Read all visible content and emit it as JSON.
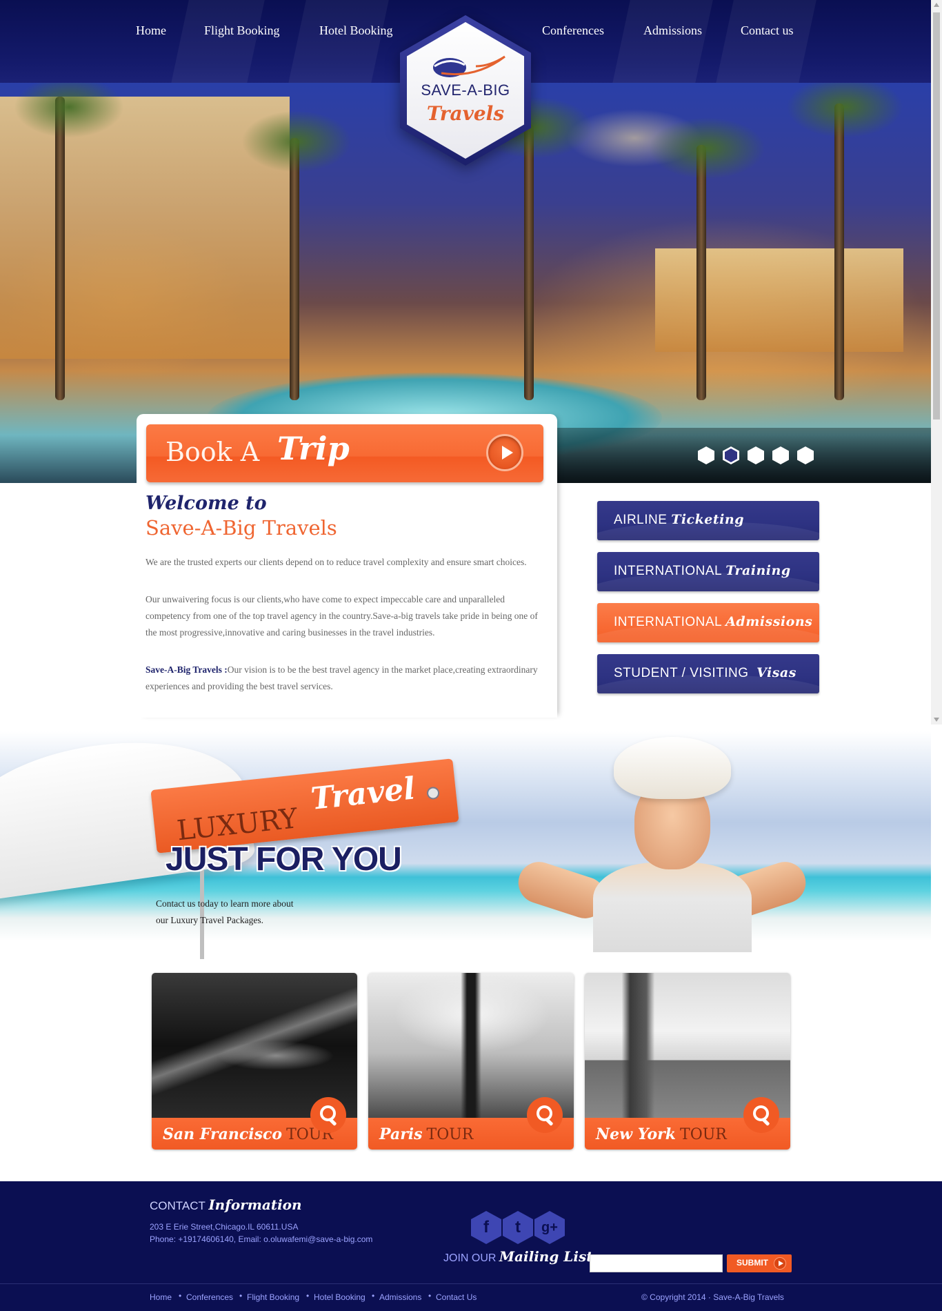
{
  "nav": {
    "items": [
      {
        "label": "Home"
      },
      {
        "label": "Flight Booking"
      },
      {
        "label": "Hotel Booking"
      },
      {
        "label": "Conferences"
      },
      {
        "label": "Admissions"
      },
      {
        "label": "Contact us"
      }
    ]
  },
  "logo": {
    "line1": "SAVE-A-BIG",
    "line2": "Travels"
  },
  "slider": {
    "dots": 5,
    "active_index": 1
  },
  "book": {
    "label_plain": "Book A",
    "label_script": "Trip",
    "icon": "play-icon"
  },
  "welcome": {
    "script": "Welcome to",
    "title": "Save-A-Big Travels",
    "p1": "We are the trusted experts our clients depend on to reduce travel complexity and ensure smart choices.",
    "p2": "Our unwaivering focus is our clients,who have come to expect impeccable care and unparalleled competency from one of the top travel agency in the country.Save-a-big travels take pride in being one of the most progressive,innovative and caring businesses in the travel industries.",
    "p3_bold": "Save-A-Big Travels :",
    "p3": "Our vision is to be the best travel agency in the market place,creating extraordinary experiences and providing the best travel services."
  },
  "services": [
    {
      "plain": "AIRLINE",
      "script": "Ticketing",
      "color": "#2d3282"
    },
    {
      "plain": "INTERNATIONAL",
      "script": "Training",
      "color": "#2d3282"
    },
    {
      "plain": "INTERNATIONAL",
      "script": "Admissions",
      "color": "#f86a34"
    },
    {
      "plain": "STUDENT / VISITING",
      "script": "Visas",
      "color": "#2d3282"
    }
  ],
  "luxury": {
    "tag_plain": "LUXURY",
    "tag_script": "Travel",
    "headline": "JUST FOR YOU",
    "text_line1": "Contact us today to learn more about",
    "text_line2": "our Luxury Travel Packages."
  },
  "tours": [
    {
      "script": "San Francisco",
      "plain": "TOUR"
    },
    {
      "script": "Paris",
      "plain": "TOUR"
    },
    {
      "script": "New York",
      "plain": "TOUR"
    }
  ],
  "footer": {
    "contact_plain": "CONTACT",
    "contact_script": "Information",
    "address": "203 E Erie Street,Chicago.IL 60611.USA",
    "phone_email": "Phone: +19174606140, Email: o.oluwafemi@save-a-big.com",
    "social": [
      {
        "icon": "facebook-icon",
        "glyph": "f"
      },
      {
        "icon": "twitter-icon",
        "glyph": "t"
      },
      {
        "icon": "google-plus-icon",
        "glyph": "g+"
      }
    ],
    "join_plain": "JOIN OUR",
    "join_script": "Mailing List",
    "email_placeholder": "",
    "submit_label": "SUBMIT",
    "links": [
      "Home",
      "Conferences",
      "Flight Booking",
      "Hotel Booking",
      "Admissions",
      "Contact Us"
    ],
    "copyright": "© Copyright 2014  ·  Save-A-Big Travels"
  },
  "colors": {
    "navy": "#0b0f52",
    "accent_orange": "#f15a24",
    "button_blue": "#2d3282"
  }
}
